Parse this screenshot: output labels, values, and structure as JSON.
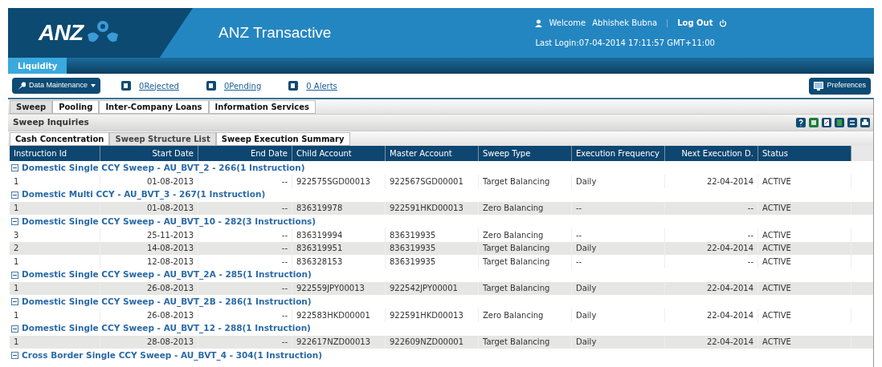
{
  "header": {
    "logo": "ANZ",
    "app_title": "ANZ Transactive",
    "welcome": "Welcome",
    "user": "Abhishek Bubna",
    "logout": "Log Out",
    "last_login": "Last Login:07-04-2014 17:11:57 GMT+11:00"
  },
  "module_tab": {
    "label": "Liquidity",
    "selected": true
  },
  "toolbar": {
    "menu_button": "Data Maintenance",
    "links": [
      {
        "label": "0Rejected"
      },
      {
        "label": "0Pending"
      },
      {
        "label": "0 Alerts"
      }
    ],
    "preferences": "Preferences"
  },
  "tabs": [
    {
      "label": "Sweep",
      "selected": true
    },
    {
      "label": "Pooling",
      "selected": false
    },
    {
      "label": "Inter-Company Loans",
      "selected": false
    },
    {
      "label": "Information Services",
      "selected": false
    }
  ],
  "section_title": "Sweep Inquiries",
  "sub_tabs": [
    {
      "label": "Cash Concentration",
      "selected": false
    },
    {
      "label": "Sweep Structure List",
      "selected": true
    },
    {
      "label": "Sweep Execution Summary",
      "selected": false
    }
  ],
  "table": {
    "columns": [
      "Instruction Id",
      "Start Date",
      "End Date",
      "Child Account",
      "Master Account",
      "Sweep Type",
      "Execution Frequency",
      "Next Execution D.",
      "Status"
    ],
    "groups": [
      {
        "title": "Domestic Single CCY Sweep - AU_BVT_2 - 266(1 Instruction)",
        "expanded": true,
        "rows": [
          [
            "1",
            "01-08-2013",
            "--",
            "922575SGD00013",
            "922567SGD00001",
            "Target Balancing",
            "Daily",
            "22-04-2014",
            "ACTIVE"
          ]
        ]
      },
      {
        "title": "Domestic Multi CCY - AU_BVT_3 - 267(1 Instruction)",
        "expanded": true,
        "rows": [
          [
            "1",
            "01-08-2013",
            "--",
            "836319978",
            "922591HKD00013",
            "Zero Balancing",
            "--",
            "--",
            "ACTIVE"
          ]
        ]
      },
      {
        "title": "Domestic Single CCY Sweep - AU_BVT_10 - 282(3 Instructions)",
        "expanded": true,
        "rows": [
          [
            "3",
            "25-11-2013",
            "--",
            "836319994",
            "836319935",
            "Zero Balancing",
            "--",
            "--",
            "ACTIVE"
          ],
          [
            "2",
            "14-08-2013",
            "--",
            "836319951",
            "836319935",
            "Target Balancing",
            "Daily",
            "22-04-2014",
            "ACTIVE"
          ],
          [
            "1",
            "12-08-2013",
            "--",
            "836328153",
            "836319935",
            "Target Balancing",
            "--",
            "--",
            "ACTIVE"
          ]
        ]
      },
      {
        "title": "Domestic Single CCY Sweep - AU_BVT_2A - 285(1 Instruction)",
        "expanded": true,
        "rows": [
          [
            "1",
            "26-08-2013",
            "--",
            "922559JPY00013",
            "922542JPY00001",
            "Target Balancing",
            "Daily",
            "22-04-2014",
            "ACTIVE"
          ]
        ]
      },
      {
        "title": "Domestic Single CCY Sweep - AU_BVT_2B - 286(1 Instruction)",
        "expanded": true,
        "rows": [
          [
            "1",
            "26-08-2013",
            "--",
            "922583HKD00001",
            "922591HKD00013",
            "Zero Balancing",
            "Daily",
            "22-04-2014",
            "ACTIVE"
          ]
        ]
      },
      {
        "title": "Domestic Single CCY Sweep - AU_BVT_12 - 288(1 Instruction)",
        "expanded": true,
        "rows": [
          [
            "1",
            "28-08-2013",
            "--",
            "922617NZD00013",
            "922609NZD00001",
            "Target Balancing",
            "Daily",
            "22-04-2014",
            "ACTIVE"
          ]
        ]
      },
      {
        "title": "Cross Border Single CCY Sweep - AU_BVT_4 - 304(1 Instruction)",
        "expanded": true
      }
    ]
  }
}
